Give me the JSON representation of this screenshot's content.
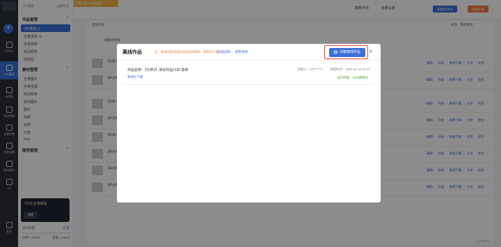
{
  "rail": {
    "logo": "720云",
    "add_label": "开始创作",
    "items": [
      {
        "label": "工作台"
      },
      {
        "label": "720漫游"
      },
      {
        "label": "云相册"
      },
      {
        "label": "活动视频"
      },
      {
        "label": "全景视频"
      },
      {
        "label": "全景直播"
      },
      {
        "label": "简单创作"
      },
      {
        "label": "VR"
      },
      {
        "label": "更多"
      }
    ]
  },
  "sidebar": {
    "header_left": "720漫游",
    "header_right": "全部作品",
    "sections": [
      {
        "title": "作品管理",
        "items": [
          {
            "label": "720漫游",
            "tag": "新",
            "active": true
          },
          {
            "label": "全景漫游",
            "tag": "新",
            "active": false
          },
          {
            "label": "全景视频",
            "tag": "",
            "active": false
          },
          {
            "label": "高清矩阵",
            "tag": "",
            "active": false
          },
          {
            "label": "回收站",
            "tag": "",
            "active": false
          }
        ]
      },
      {
        "title": "素材管理",
        "items": [
          {
            "label": "全景图片"
          },
          {
            "label": "全景视频"
          },
          {
            "label": "高清矩阵"
          },
          {
            "label": "遮罩图片"
          },
          {
            "label": "图片"
          },
          {
            "label": "视频"
          },
          {
            "label": "音频"
          },
          {
            "label": "文案"
          },
          {
            "label": "PDF"
          }
        ]
      },
      {
        "title": "服务管理",
        "items": []
      }
    ],
    "promo": {
      "title": "720企业旗舰版",
      "button": "续费"
    },
    "storage": {
      "label": "空间容量",
      "link": "扩容",
      "used": "已用 1.08GB",
      "total": "容量 4.86TB"
    }
  },
  "topbar": {
    "promo_text": "免费了解720云旗舰版",
    "links": [
      "模板市场",
      "批量设置"
    ],
    "btn_new_folder": "新建文件夹",
    "btn_create": "创建作品"
  },
  "list": {
    "header": "漫游作品",
    "sort_label": "排序：最新修改",
    "folder_title": "测试文件夹",
    "rows": [
      {
        "title": "【分类1】测试作品1130 复制"
      },
      {
        "title": "【未分类】测试作品"
      },
      {
        "title": "【分类1】测试作品"
      },
      {
        "title": "【未分类】测试作品"
      },
      {
        "title": "【分类1】测试作品"
      },
      {
        "title": "【未分类】测试作品"
      },
      {
        "title": "【未分类】测试作品"
      },
      {
        "title": "【未分类】测试作品"
      }
    ],
    "actions": "编辑 升级 离线下载 分享 更多"
  },
  "modal": {
    "title": "离线作品",
    "note": "注：离线包生成后3天后自动清除，请及时下载",
    "link_help": "功能说明",
    "link_usage": "使用详情",
    "create_button": "创建离线作品",
    "close": "×",
    "card": {
      "name_label": "作品名称：",
      "name": "【分类1】测试作品1130 复制",
      "download": "离线包下载",
      "creator": "创建人：167******...",
      "created_at": "创建时间：2024.04.19 15:14",
      "status": "运行终端：SDK数据包"
    }
  },
  "footer_right": "已完成0/4"
}
